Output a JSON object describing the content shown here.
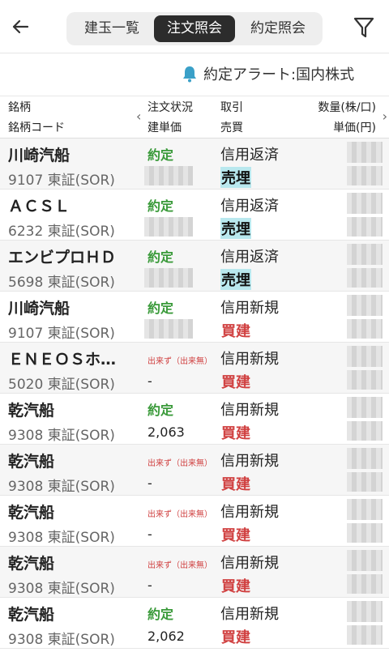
{
  "header": {
    "tabs": [
      "建玉一覧",
      "注文照会",
      "約定照会"
    ],
    "active_tab": "注文照会"
  },
  "alert": {
    "text": "約定アラート:国内株式"
  },
  "columns": {
    "name": "銘柄",
    "code": "銘柄コード",
    "status": "注文状況",
    "price": "建単価",
    "trade": "取引",
    "side": "売買",
    "qty": "数量(株/口)",
    "unit_price": "単価(円)"
  },
  "rows": [
    {
      "name": "川崎汽船",
      "code": "9107 東証(SOR)",
      "status": "約定",
      "price": "",
      "type": "信用返済",
      "side": "売埋"
    },
    {
      "name": "ＡＣＳＬ",
      "code": "6232 東証(SOR)",
      "status": "約定",
      "price": "",
      "type": "信用返済",
      "side": "売埋"
    },
    {
      "name": "エンビプロＨＤ",
      "code": "5698 東証(SOR)",
      "status": "約定",
      "price": "",
      "type": "信用返済",
      "side": "売埋"
    },
    {
      "name": "川崎汽船",
      "code": "9107 東証(SOR)",
      "status": "約定",
      "price": "",
      "type": "信用新規",
      "side": "買建"
    },
    {
      "name": "ＥＮＥＯＳホ…",
      "code": "5020 東証(SOR)",
      "status": "出来ず（出来無）",
      "price": "-",
      "type": "信用新規",
      "side": "買建"
    },
    {
      "name": "乾汽船",
      "code": "9308 東証(SOR)",
      "status": "約定",
      "price": "2,063",
      "type": "信用新規",
      "side": "買建"
    },
    {
      "name": "乾汽船",
      "code": "9308 東証(SOR)",
      "status": "出来ず（出来無）",
      "price": "-",
      "type": "信用新規",
      "side": "買建"
    },
    {
      "name": "乾汽船",
      "code": "9308 東証(SOR)",
      "status": "出来ず（出来無）",
      "price": "-",
      "type": "信用新規",
      "side": "買建"
    },
    {
      "name": "乾汽船",
      "code": "9308 東証(SOR)",
      "status": "出来ず（出来無）",
      "price": "-",
      "type": "信用新規",
      "side": "買建"
    },
    {
      "name": "乾汽船",
      "code": "9308 東証(SOR)",
      "status": "約定",
      "price": "2,062",
      "type": "信用新規",
      "side": "買建"
    }
  ]
}
